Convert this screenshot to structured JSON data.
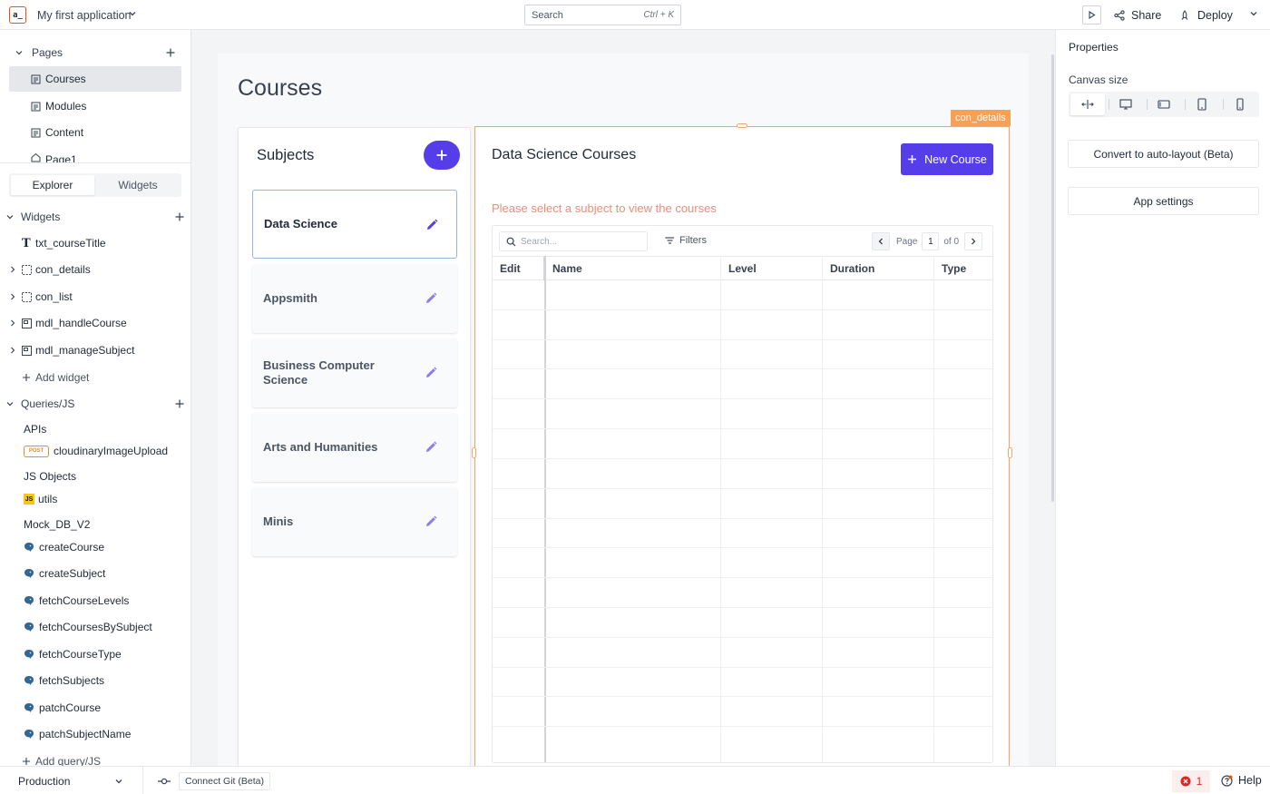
{
  "header": {
    "logo_text": "a_",
    "app_name": "My first application",
    "search_placeholder": "Search",
    "search_shortcut": "Ctrl + K",
    "share_label": "Share",
    "deploy_label": "Deploy"
  },
  "sidebar": {
    "pages_label": "Pages",
    "pages": [
      {
        "label": "Courses",
        "active": true
      },
      {
        "label": "Modules",
        "active": false
      },
      {
        "label": "Content",
        "active": false
      },
      {
        "label": "Page1",
        "active": false
      }
    ],
    "tabs": [
      "Explorer",
      "Widgets"
    ],
    "widgets_label": "Widgets",
    "widgets": [
      {
        "label": "txt_courseTitle",
        "icon": "text-icon",
        "expandable": false
      },
      {
        "label": "con_details",
        "icon": "container-icon",
        "expandable": true
      },
      {
        "label": "con_list",
        "icon": "container-icon",
        "expandable": true
      },
      {
        "label": "mdl_handleCourse",
        "icon": "modal-icon",
        "expandable": true
      },
      {
        "label": "mdl_manageSubject",
        "icon": "modal-icon",
        "expandable": true
      }
    ],
    "add_widget_label": "Add widget",
    "queries_label": "Queries/JS",
    "apis_label": "APIs",
    "api_items": [
      {
        "label": "cloudinaryImageUpload",
        "badge": "POST"
      }
    ],
    "js_label": "JS Objects",
    "js_items": [
      {
        "label": "utils",
        "badge": "JS"
      }
    ],
    "db_label": "Mock_DB_V2",
    "db_items": [
      "createCourse",
      "createSubject",
      "fetchCourseLevels",
      "fetchCoursesBySubject",
      "fetchCourseType",
      "fetchSubjects",
      "patchCourse",
      "patchSubjectName"
    ],
    "add_query_label": "Add query/JS"
  },
  "canvas": {
    "page_title": "Courses",
    "subjects_title": "Subjects",
    "subjects": [
      {
        "label": "Data Science",
        "selected": true
      },
      {
        "label": "Appsmith",
        "selected": false
      },
      {
        "label": "Business Computer Science",
        "selected": false
      },
      {
        "label": "Arts and Humanities",
        "selected": false
      },
      {
        "label": "Minis",
        "selected": false
      }
    ],
    "details_tag": "con_details",
    "details_title": "Data Science Courses",
    "new_course_label": "New Course",
    "notice": "Please select a subject to view the courses",
    "table": {
      "search_placeholder": "Search...",
      "filters_label": "Filters",
      "page_label": "Page",
      "page_value": "1",
      "page_of": "of 0",
      "columns": [
        "Edit",
        "Name",
        "Level",
        "Duration",
        "Type"
      ]
    }
  },
  "properties": {
    "title": "Properties",
    "canvas_size_label": "Canvas size",
    "size_options": [
      "fluid-width-icon",
      "desktop-icon",
      "tablet-landscape-icon",
      "tablet-portrait-icon",
      "mobile-icon"
    ],
    "auto_layout_label": "Convert to auto-layout (Beta)",
    "app_settings_label": "App settings"
  },
  "bottombar": {
    "environment": "Production",
    "git_label": "Connect Git (Beta)",
    "error_count": "1",
    "help_label": "Help"
  },
  "colors": {
    "primary": "#553de9",
    "selection": "#f5a56a",
    "notice": "#f08b7b",
    "brand": "#e15615"
  }
}
